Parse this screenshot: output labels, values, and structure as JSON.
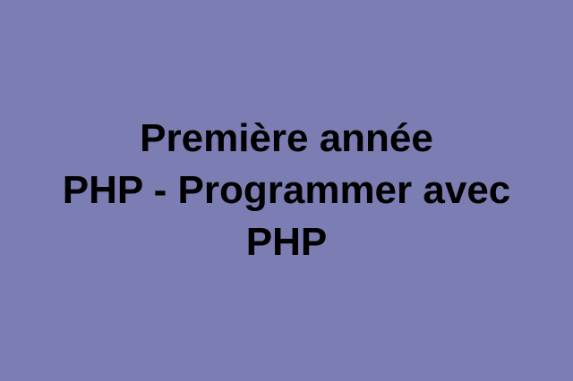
{
  "banner": {
    "background_color": "#7b7db3",
    "text_color": "#000000",
    "lines": [
      "Première année",
      "PHP - Programmer avec",
      "PHP"
    ]
  }
}
